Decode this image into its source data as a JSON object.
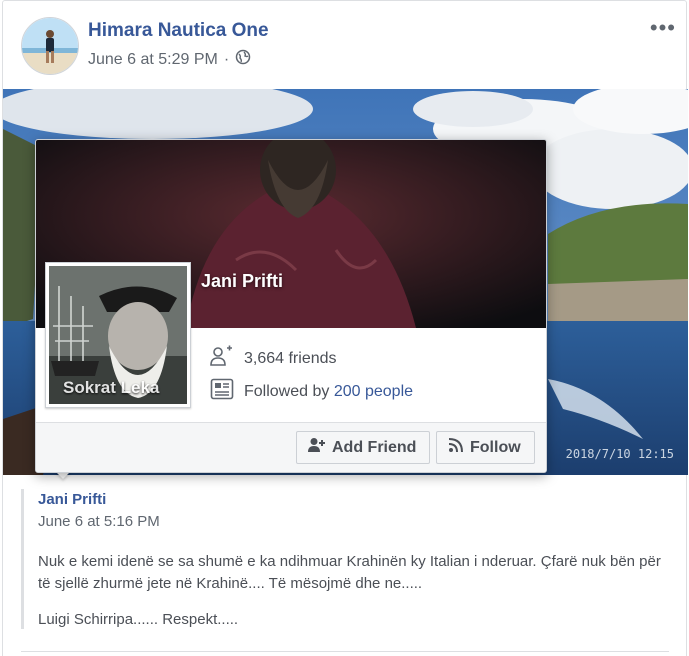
{
  "post": {
    "author": "Himara Nautica One",
    "date": "June 6 at 5:29 PM",
    "separator": "·",
    "more_label": "•••",
    "privacy_icon": "globe-icon"
  },
  "photo": {
    "timestamp": "2018/7/10  12:15"
  },
  "hovercard": {
    "name": "Jani Prifti",
    "profile_caption": "Sokrat Leka",
    "friends": "3,664 friends",
    "followed_prefix": "Followed by ",
    "followed_link": "200 people",
    "add_friend_label": "Add Friend",
    "follow_label": "Follow"
  },
  "shared_post": {
    "author": "Jani Prifti",
    "date": "June 6 at 5:16 PM",
    "text": "Nuk e kemi idenë se sa shumë e ka ndihmuar Krahinën ky Italian i nderuar. Çfarë nuk bën për të sjellë zhurmë jete në Krahinë.... Të mësojmë dhe ne.....",
    "text2": "Luigi Schirripa...... Respekt....."
  },
  "colors": {
    "link": "#385898",
    "secondary_text": "#606770",
    "border": "#dddfe2"
  }
}
